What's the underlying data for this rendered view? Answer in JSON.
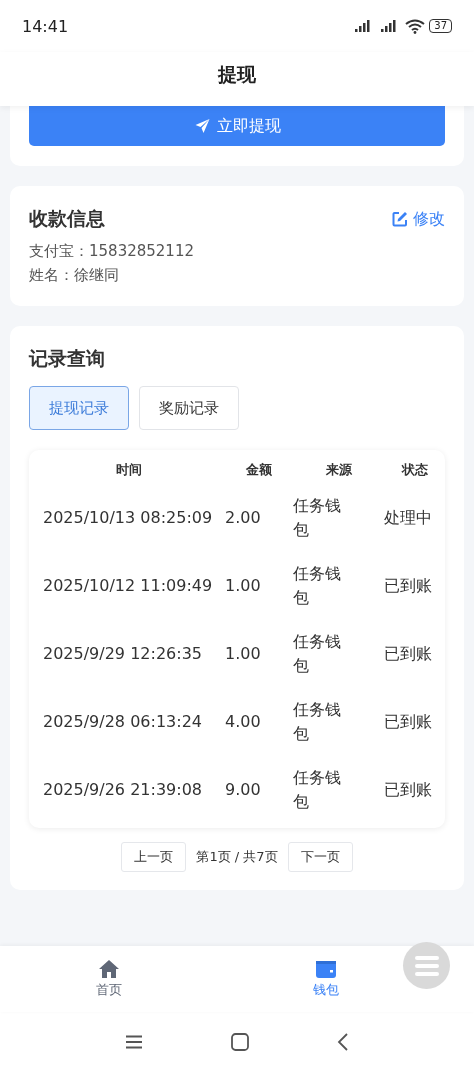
{
  "status_bar": {
    "time": "14:41",
    "battery": "37"
  },
  "header": {
    "title": "提现"
  },
  "withdraw_button": {
    "label": "立即提现"
  },
  "payee_card": {
    "title": "收款信息",
    "edit_link": "修改",
    "lines": [
      "支付宝：15832852112",
      "姓名：徐继同"
    ]
  },
  "records_card": {
    "title": "记录查询",
    "tabs": [
      {
        "label": "提现记录",
        "selected": true
      },
      {
        "label": "奖励记录",
        "selected": false
      }
    ],
    "table": {
      "columns": [
        "时间",
        "金额",
        "来源",
        "状态"
      ],
      "rows": [
        [
          "2025/10/13 08:25:09",
          "2.00",
          "任务钱包",
          "处理中"
        ],
        [
          "2025/10/12 11:09:49",
          "1.00",
          "任务钱包",
          "已到账"
        ],
        [
          "2025/9/29 12:26:35",
          "1.00",
          "任务钱包",
          "已到账"
        ],
        [
          "2025/9/28 06:13:24",
          "4.00",
          "任务钱包",
          "已到账"
        ],
        [
          "2025/9/26 21:39:08",
          "9.00",
          "任务钱包",
          "已到账"
        ]
      ]
    },
    "pagination": {
      "prev": "上一页",
      "info": "第1页 / 共7页",
      "next": "下一页"
    }
  },
  "bottom_nav": [
    {
      "label": "首页",
      "kind": "home",
      "selected": false
    },
    {
      "label": "钱包",
      "kind": "wallet",
      "selected": true
    }
  ]
}
